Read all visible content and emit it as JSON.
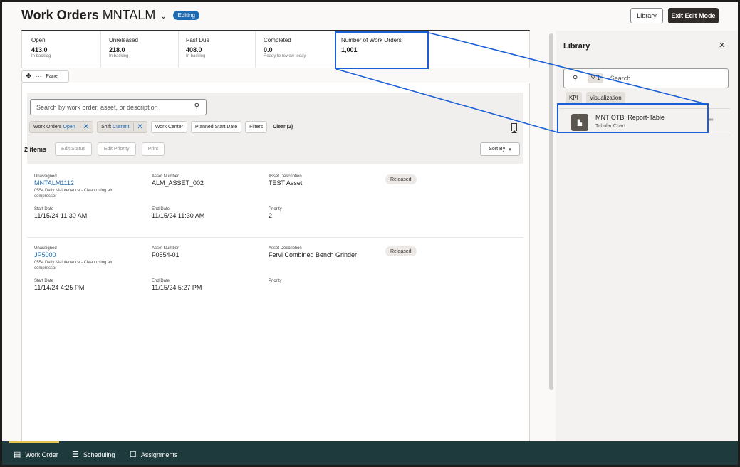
{
  "header": {
    "title_main": "Work Orders",
    "title_sub": "MNTALM",
    "chevron": "chevron-down-icon",
    "badge": "Editing",
    "library_button": "Library",
    "exit_button": "Exit Edit Mode"
  },
  "kpis": [
    {
      "label": "Open",
      "value": "413.0",
      "sub": "In backlog"
    },
    {
      "label": "Unreleased",
      "value": "218.0",
      "sub": "In backlog"
    },
    {
      "label": "Past Due",
      "value": "408.0",
      "sub": "In backlog"
    },
    {
      "label": "Completed",
      "value": "0.0",
      "sub": "Ready to review today"
    },
    {
      "label": "Number of Work Orders",
      "value": "1,001",
      "sub": ""
    }
  ],
  "panel_toolbar": {
    "label": "Panel",
    "move_icon": "move-icon",
    "more_icon": "more-icon"
  },
  "search": {
    "placeholder": "Search by work order, asset, or description",
    "icon": "search-icon"
  },
  "filters": {
    "chips": [
      {
        "name": "Work Orders",
        "value": "Open",
        "active": true
      },
      {
        "name": "Shift",
        "value": "Current",
        "active": true
      },
      {
        "name": "Work Center",
        "value": "",
        "active": false
      },
      {
        "name": "Planned Start Date",
        "value": "",
        "active": false
      },
      {
        "name": "Filters",
        "value": "",
        "active": false
      }
    ],
    "clear": "Clear (2)"
  },
  "actions": {
    "count": "2 items",
    "edit_status": "Edit Status",
    "edit_priority": "Edit Priority",
    "print": "Print",
    "sort_by": "Sort By"
  },
  "work_orders": [
    {
      "assignee": "Unassigned",
      "number": "MNTALM1112",
      "description": "0554 Daily Maintenance - Clean using air compressor",
      "asset_number_label": "Asset Number",
      "asset_number": "ALM_ASSET_002",
      "asset_desc_label": "Asset Description",
      "asset_desc": "TEST Asset",
      "status": "Released",
      "start_label": "Start Date",
      "start": "11/15/24 11:30 AM",
      "end_label": "End Date",
      "end": "11/15/24 11:30 AM",
      "priority_label": "Priority",
      "priority": "2"
    },
    {
      "assignee": "Unassigned",
      "number": "JP5000",
      "description": "0554 Daily Maintenance - Clean using air compressor",
      "asset_number_label": "Asset Number",
      "asset_number": "F0554-01",
      "asset_desc_label": "Asset Description",
      "asset_desc": "Fervi Combined Bench Grinder",
      "status": "Released",
      "start_label": "Start Date",
      "start": "11/14/24 4:25 PM",
      "end_label": "End Date",
      "end": "11/15/24 5:27 PM",
      "priority_label": "Priority",
      "priority": ""
    }
  ],
  "library": {
    "title": "Library",
    "close_icon": "close-icon",
    "search_placeholder": "Search",
    "filter_count": "1",
    "tabs": [
      "KPI",
      "Visualization"
    ],
    "items": [
      {
        "name": "MNT OTBI Report-Table",
        "type": "Tabular Chart",
        "icon": "chart-icon"
      }
    ]
  },
  "bottom_nav": [
    {
      "label": "Work Order",
      "icon": "work-order-icon",
      "active": true
    },
    {
      "label": "Scheduling",
      "icon": "scheduling-icon",
      "active": false
    },
    {
      "label": "Assignments",
      "icon": "assignments-icon",
      "active": false
    }
  ],
  "colors": {
    "accent": "#1e6bb3",
    "highlight": "#1a5fd6",
    "nav_bg": "#1f3a3d"
  }
}
